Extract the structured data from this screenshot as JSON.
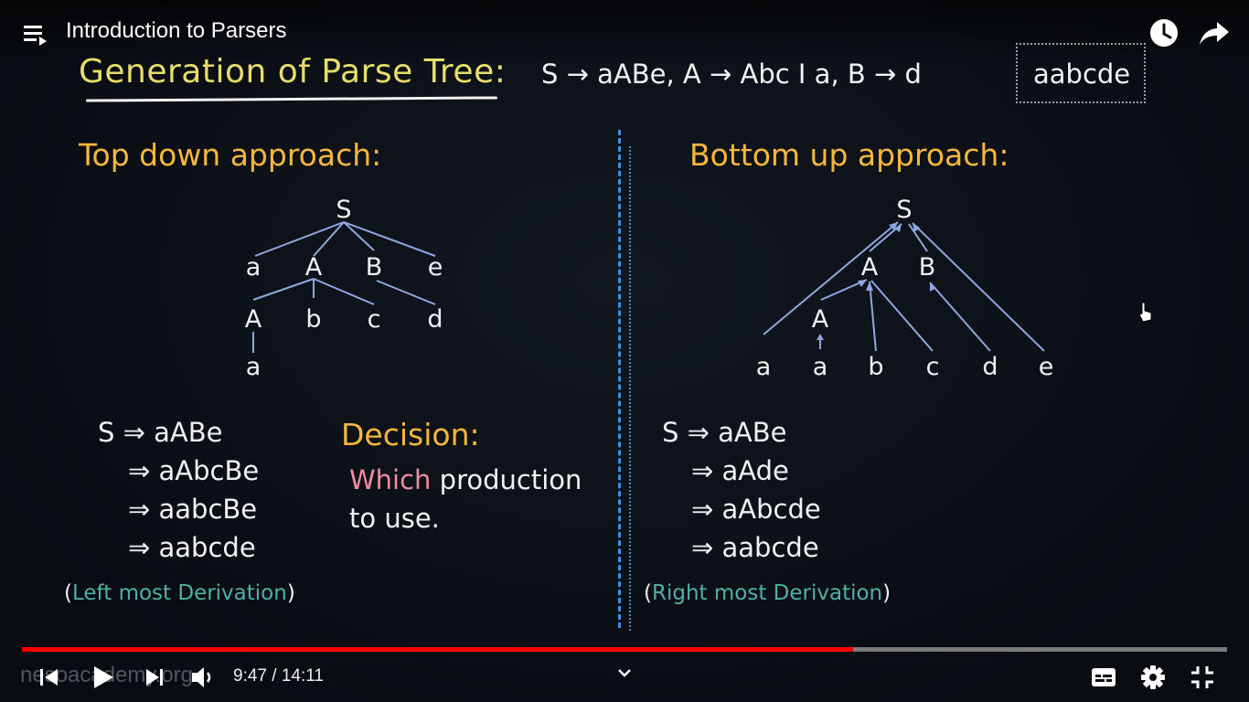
{
  "player": {
    "video_title": "Introduction to Parsers",
    "time_text": "9:47 / 14:11",
    "progress": 0.69,
    "watermark": "nesoacademy.org"
  },
  "slide": {
    "title": "Generation of Parse Tree:",
    "grammar": "S → aABe, A → Abc I a, B → d",
    "input_string": "aabcde",
    "top_down": {
      "heading": "Top down approach:",
      "derivation": [
        "S ⇒ aABe",
        "⇒ aAbcBe",
        "⇒ aabcBe",
        "⇒ aabcde"
      ],
      "note_open": "(",
      "note_text": "Left most Derivation",
      "note_close": ")"
    },
    "decision": {
      "heading": "Decision:",
      "line1_highlight": "Which",
      "line1_rest": " production",
      "line2": "to use."
    },
    "bottom_up": {
      "heading": "Bottom up approach:",
      "derivation": [
        "S ⇒ aABe",
        "⇒ aAde",
        "⇒ aAbcde",
        "⇒ aabcde"
      ],
      "note_open": "(",
      "note_text": "Right most Derivation",
      "note_close": ")"
    },
    "td_tree": {
      "root": "S",
      "level1": [
        "a",
        "A",
        "B",
        "e"
      ],
      "level2": [
        "A",
        "b",
        "c",
        "d"
      ],
      "level3": [
        "a"
      ]
    },
    "bu_tree": {
      "root": "S",
      "level1": [
        "A",
        "B"
      ],
      "level2": [
        "A"
      ],
      "leaves": [
        "a",
        "a",
        "b",
        "c",
        "d",
        "e"
      ]
    }
  },
  "colors": {
    "title": "#e8dc6a",
    "section_heading": "#f7b73a",
    "teal_note": "#4fb0a8",
    "pink_highlight": "#f08ba0",
    "tree_edge": "#8fa6e0",
    "divider": "#3d8fe0",
    "progress_played": "#ff0000"
  },
  "icons": {
    "menu": "playlist-icon",
    "watch_later": "clock-icon",
    "share": "share-icon",
    "prev": "previous-icon",
    "play": "play-icon",
    "next": "next-icon",
    "volume": "volume-icon",
    "chevron": "chevron-down-icon",
    "captions": "subtitles-icon",
    "settings": "gear-icon",
    "exit_fullscreen": "exit-fullscreen-icon"
  }
}
